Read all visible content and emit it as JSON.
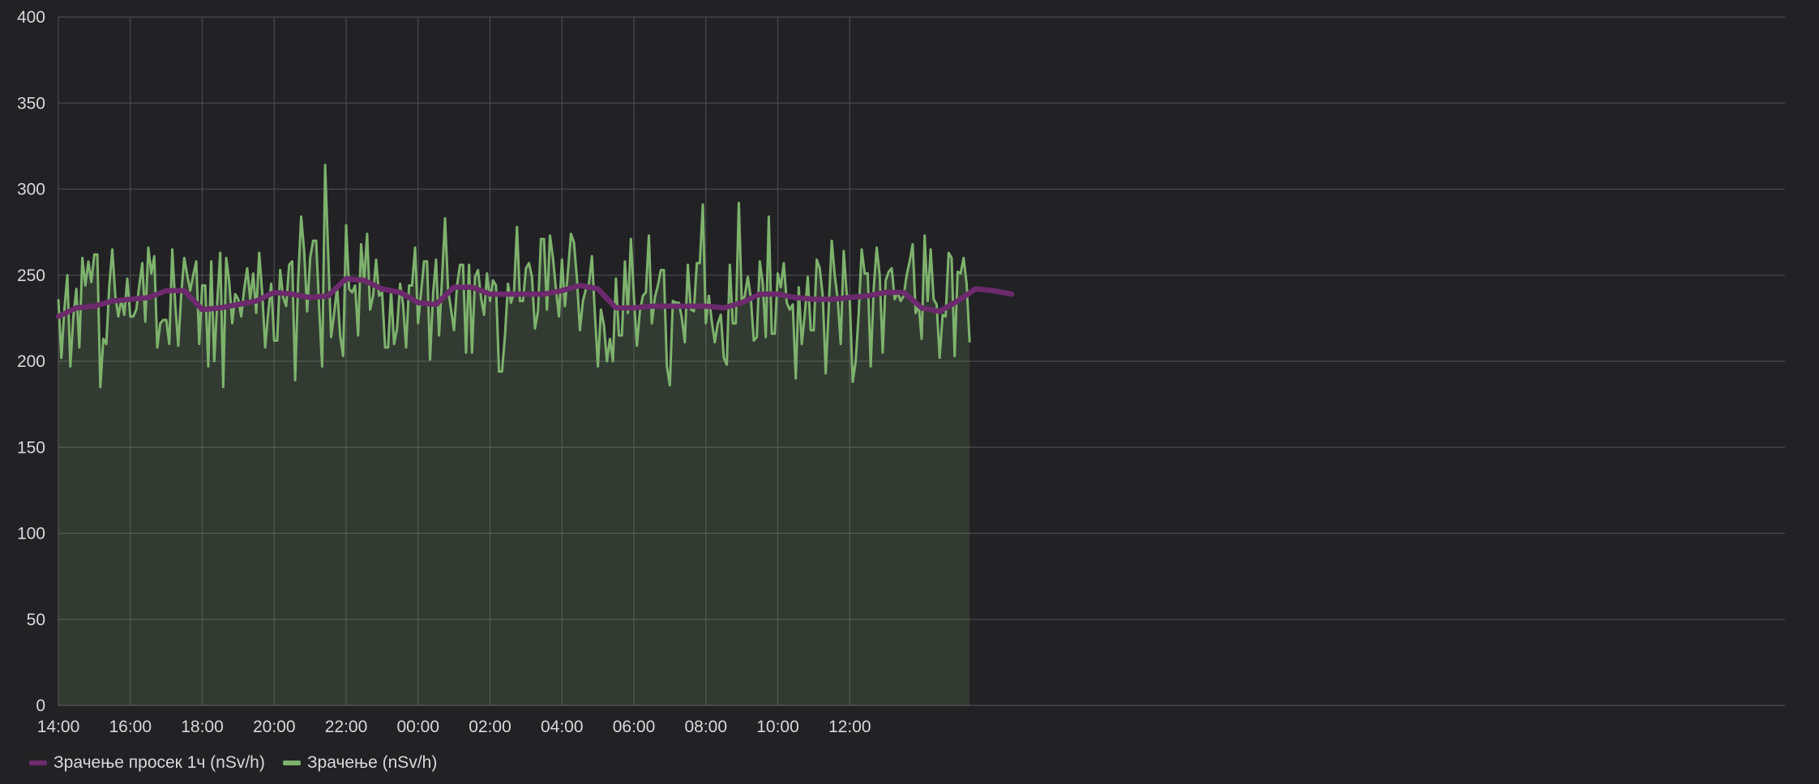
{
  "chart_data": {
    "type": "line",
    "title": "",
    "xlabel": "",
    "ylabel": "",
    "ylim": [
      0,
      400
    ],
    "y_ticks": [
      "0",
      "50",
      "100",
      "150",
      "200",
      "250",
      "300",
      "350",
      "400"
    ],
    "x_ticks": [
      "14:00",
      "16:00",
      "18:00",
      "20:00",
      "22:00",
      "00:00",
      "02:00",
      "04:00",
      "06:00",
      "08:00",
      "10:00",
      "12:00"
    ],
    "x_start": "14:00",
    "x_end": "13:47",
    "grid": true,
    "legend_position": "bottom-left",
    "series": [
      {
        "name": "Зрачење просек 1ч (nSv/h)",
        "color": "#6d2a6d",
        "fill": false,
        "time_step_min": 30,
        "values": [
          226,
          231,
          232,
          235,
          236,
          237,
          241,
          241,
          230,
          231,
          233,
          235,
          240,
          239,
          237,
          238,
          248,
          247,
          242,
          240,
          234,
          233,
          243,
          243,
          239,
          239,
          239,
          239,
          241,
          244,
          242,
          231,
          231,
          232,
          232,
          232,
          232,
          231,
          234,
          239,
          239,
          237,
          236,
          236,
          237,
          238,
          240,
          240,
          231,
          229,
          235,
          242,
          241,
          239
        ]
      },
      {
        "name": "Зрачење (nSv/h)",
        "color": "#7eb26d",
        "fill": true,
        "time_step_min": 5,
        "values": [
          236,
          202,
          230,
          250,
          197,
          226,
          242,
          208,
          260,
          244,
          258,
          246,
          262,
          262,
          185,
          213,
          210,
          244,
          265,
          238,
          226,
          236,
          227,
          248,
          226,
          226,
          230,
          244,
          257,
          223,
          266,
          251,
          261,
          208,
          222,
          224,
          224,
          210,
          265,
          233,
          209,
          239,
          260,
          250,
          241,
          250,
          258,
          210,
          244,
          244,
          197,
          258,
          200,
          234,
          263,
          185,
          260,
          246,
          222,
          239,
          236,
          226,
          242,
          254,
          236,
          251,
          228,
          263,
          240,
          208,
          228,
          245,
          212,
          212,
          253,
          237,
          232,
          256,
          258,
          189,
          247,
          284,
          264,
          229,
          260,
          270,
          270,
          231,
          197,
          314,
          263,
          214,
          228,
          243,
          215,
          203,
          279,
          242,
          240,
          244,
          215,
          268,
          246,
          274,
          230,
          238,
          259,
          238,
          240,
          208,
          208,
          241,
          210,
          219,
          245,
          233,
          208,
          244,
          244,
          266,
          222,
          240,
          258,
          258,
          201,
          239,
          259,
          215,
          248,
          283,
          242,
          230,
          218,
          244,
          256,
          256,
          205,
          256,
          205,
          249,
          253,
          237,
          227,
          251,
          235,
          247,
          244,
          194,
          194,
          215,
          245,
          234,
          240,
          278,
          235,
          235,
          254,
          257,
          249,
          219,
          229,
          271,
          271,
          230,
          273,
          260,
          242,
          226,
          259,
          232,
          252,
          274,
          269,
          248,
          218,
          235,
          242,
          245,
          261,
          227,
          197,
          230,
          221,
          200,
          213,
          200,
          248,
          215,
          215,
          258,
          228,
          271,
          238,
          209,
          229,
          238,
          240,
          273,
          222,
          237,
          244,
          253,
          253,
          197,
          186,
          235,
          234,
          234,
          225,
          211,
          256,
          230,
          229,
          257,
          257,
          291,
          222,
          238,
          223,
          211,
          222,
          227,
          202,
          198,
          256,
          222,
          222,
          292,
          234,
          238,
          249,
          237,
          212,
          214,
          258,
          245,
          214,
          284,
          216,
          216,
          251,
          243,
          257,
          234,
          230,
          233,
          190,
          243,
          210,
          227,
          249,
          218,
          218,
          259,
          254,
          238,
          193,
          231,
          270,
          250,
          236,
          210,
          264,
          239,
          236,
          188,
          200,
          228,
          265,
          251,
          251,
          197,
          242,
          266,
          250,
          205,
          247,
          252,
          254,
          236,
          240,
          235,
          238,
          250,
          258,
          268,
          228,
          233,
          213,
          273,
          235,
          265,
          236,
          233,
          202,
          227,
          226,
          263,
          260,
          203,
          252,
          251,
          260,
          245,
          211
        ]
      }
    ]
  }
}
